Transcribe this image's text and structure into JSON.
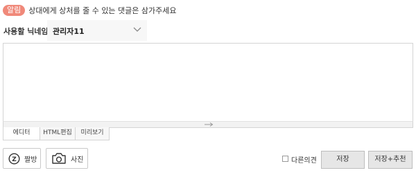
{
  "colors": {
    "notice_badge": "#f0897a",
    "panel_bg": "#f7f7f7",
    "border": "#d4d4d4",
    "button_bg": "#e6e6e6"
  },
  "notice": {
    "badge": "알림",
    "text": "상대에게 상처를 줄 수 있는 댓글은 삼가주세요"
  },
  "nickname": {
    "label": "사용할 닉네임:",
    "value": "관리자11",
    "icon": "chevron-down-icon"
  },
  "editor": {
    "value": "",
    "resize_icon": "resize-handle-icon"
  },
  "mode_tabs": [
    {
      "label": "에디터",
      "active": true
    },
    {
      "label": "HTML편집",
      "active": false
    },
    {
      "label": "미리보기",
      "active": false
    }
  ],
  "tools": {
    "emoticon": {
      "label": "짤방",
      "icon": "emoticon-icon"
    },
    "photo": {
      "label": "사진",
      "icon": "camera-icon"
    }
  },
  "secret": {
    "label": "다른의견",
    "checked": false
  },
  "actions": {
    "save": "저장",
    "save_recommend": "저장+추천"
  }
}
